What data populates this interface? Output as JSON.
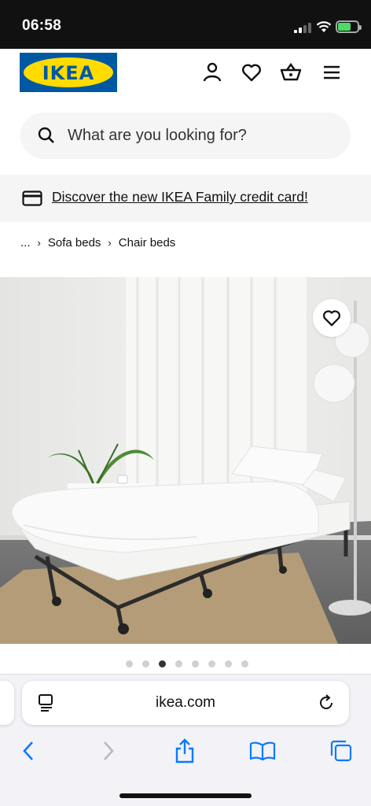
{
  "status_bar": {
    "time": "06:58"
  },
  "header": {
    "logo_text": "IKEA",
    "icons": [
      "account-icon",
      "heart-icon",
      "basket-icon",
      "menu-icon"
    ]
  },
  "search": {
    "placeholder": "What are you looking for?"
  },
  "banner": {
    "icon": "credit-card-icon",
    "link_text": "Discover the new IKEA Family credit card!"
  },
  "breadcrumb": {
    "ellipsis": "...",
    "items": [
      "Sofa beds",
      "Chair beds"
    ]
  },
  "gallery": {
    "total_images": 8,
    "active_index": 2
  },
  "browser": {
    "url": "ikea.com",
    "toolbar_icons": [
      "back-icon",
      "forward-icon",
      "share-icon",
      "bookmarks-icon",
      "tabs-icon"
    ]
  },
  "colors": {
    "ikea_blue": "#0058a3",
    "ikea_yellow": "#ffdb00",
    "safari_blue": "#0a7aff"
  }
}
